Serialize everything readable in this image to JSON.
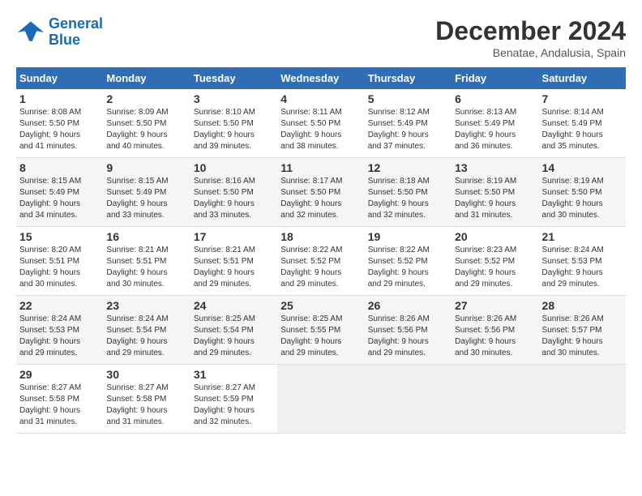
{
  "logo": {
    "line1": "General",
    "line2": "Blue"
  },
  "title": "December 2024",
  "location": "Benatae, Andalusia, Spain",
  "weekdays": [
    "Sunday",
    "Monday",
    "Tuesday",
    "Wednesday",
    "Thursday",
    "Friday",
    "Saturday"
  ],
  "days": [
    {
      "num": "",
      "info": ""
    },
    {
      "num": "",
      "info": ""
    },
    {
      "num": "",
      "info": ""
    },
    {
      "num": "",
      "info": ""
    },
    {
      "num": "",
      "info": ""
    },
    {
      "num": "",
      "info": ""
    },
    {
      "num": "1",
      "info": "Sunrise: 8:08 AM\nSunset: 5:50 PM\nDaylight: 9 hours\nand 41 minutes."
    },
    {
      "num": "2",
      "info": "Sunrise: 8:09 AM\nSunset: 5:50 PM\nDaylight: 9 hours\nand 40 minutes."
    },
    {
      "num": "3",
      "info": "Sunrise: 8:10 AM\nSunset: 5:50 PM\nDaylight: 9 hours\nand 39 minutes."
    },
    {
      "num": "4",
      "info": "Sunrise: 8:11 AM\nSunset: 5:50 PM\nDaylight: 9 hours\nand 38 minutes."
    },
    {
      "num": "5",
      "info": "Sunrise: 8:12 AM\nSunset: 5:49 PM\nDaylight: 9 hours\nand 37 minutes."
    },
    {
      "num": "6",
      "info": "Sunrise: 8:13 AM\nSunset: 5:49 PM\nDaylight: 9 hours\nand 36 minutes."
    },
    {
      "num": "7",
      "info": "Sunrise: 8:14 AM\nSunset: 5:49 PM\nDaylight: 9 hours\nand 35 minutes."
    },
    {
      "num": "8",
      "info": "Sunrise: 8:15 AM\nSunset: 5:49 PM\nDaylight: 9 hours\nand 34 minutes."
    },
    {
      "num": "9",
      "info": "Sunrise: 8:15 AM\nSunset: 5:49 PM\nDaylight: 9 hours\nand 33 minutes."
    },
    {
      "num": "10",
      "info": "Sunrise: 8:16 AM\nSunset: 5:50 PM\nDaylight: 9 hours\nand 33 minutes."
    },
    {
      "num": "11",
      "info": "Sunrise: 8:17 AM\nSunset: 5:50 PM\nDaylight: 9 hours\nand 32 minutes."
    },
    {
      "num": "12",
      "info": "Sunrise: 8:18 AM\nSunset: 5:50 PM\nDaylight: 9 hours\nand 32 minutes."
    },
    {
      "num": "13",
      "info": "Sunrise: 8:19 AM\nSunset: 5:50 PM\nDaylight: 9 hours\nand 31 minutes."
    },
    {
      "num": "14",
      "info": "Sunrise: 8:19 AM\nSunset: 5:50 PM\nDaylight: 9 hours\nand 30 minutes."
    },
    {
      "num": "15",
      "info": "Sunrise: 8:20 AM\nSunset: 5:51 PM\nDaylight: 9 hours\nand 30 minutes."
    },
    {
      "num": "16",
      "info": "Sunrise: 8:21 AM\nSunset: 5:51 PM\nDaylight: 9 hours\nand 30 minutes."
    },
    {
      "num": "17",
      "info": "Sunrise: 8:21 AM\nSunset: 5:51 PM\nDaylight: 9 hours\nand 29 minutes."
    },
    {
      "num": "18",
      "info": "Sunrise: 8:22 AM\nSunset: 5:52 PM\nDaylight: 9 hours\nand 29 minutes."
    },
    {
      "num": "19",
      "info": "Sunrise: 8:22 AM\nSunset: 5:52 PM\nDaylight: 9 hours\nand 29 minutes."
    },
    {
      "num": "20",
      "info": "Sunrise: 8:23 AM\nSunset: 5:52 PM\nDaylight: 9 hours\nand 29 minutes."
    },
    {
      "num": "21",
      "info": "Sunrise: 8:24 AM\nSunset: 5:53 PM\nDaylight: 9 hours\nand 29 minutes."
    },
    {
      "num": "22",
      "info": "Sunrise: 8:24 AM\nSunset: 5:53 PM\nDaylight: 9 hours\nand 29 minutes."
    },
    {
      "num": "23",
      "info": "Sunrise: 8:24 AM\nSunset: 5:54 PM\nDaylight: 9 hours\nand 29 minutes."
    },
    {
      "num": "24",
      "info": "Sunrise: 8:25 AM\nSunset: 5:54 PM\nDaylight: 9 hours\nand 29 minutes."
    },
    {
      "num": "25",
      "info": "Sunrise: 8:25 AM\nSunset: 5:55 PM\nDaylight: 9 hours\nand 29 minutes."
    },
    {
      "num": "26",
      "info": "Sunrise: 8:26 AM\nSunset: 5:56 PM\nDaylight: 9 hours\nand 29 minutes."
    },
    {
      "num": "27",
      "info": "Sunrise: 8:26 AM\nSunset: 5:56 PM\nDaylight: 9 hours\nand 30 minutes."
    },
    {
      "num": "28",
      "info": "Sunrise: 8:26 AM\nSunset: 5:57 PM\nDaylight: 9 hours\nand 30 minutes."
    },
    {
      "num": "29",
      "info": "Sunrise: 8:27 AM\nSunset: 5:58 PM\nDaylight: 9 hours\nand 31 minutes."
    },
    {
      "num": "30",
      "info": "Sunrise: 8:27 AM\nSunset: 5:58 PM\nDaylight: 9 hours\nand 31 minutes."
    },
    {
      "num": "31",
      "info": "Sunrise: 8:27 AM\nSunset: 5:59 PM\nDaylight: 9 hours\nand 32 minutes."
    },
    {
      "num": "",
      "info": ""
    },
    {
      "num": "",
      "info": ""
    },
    {
      "num": "",
      "info": ""
    },
    {
      "num": "",
      "info": ""
    },
    {
      "num": "",
      "info": ""
    }
  ]
}
